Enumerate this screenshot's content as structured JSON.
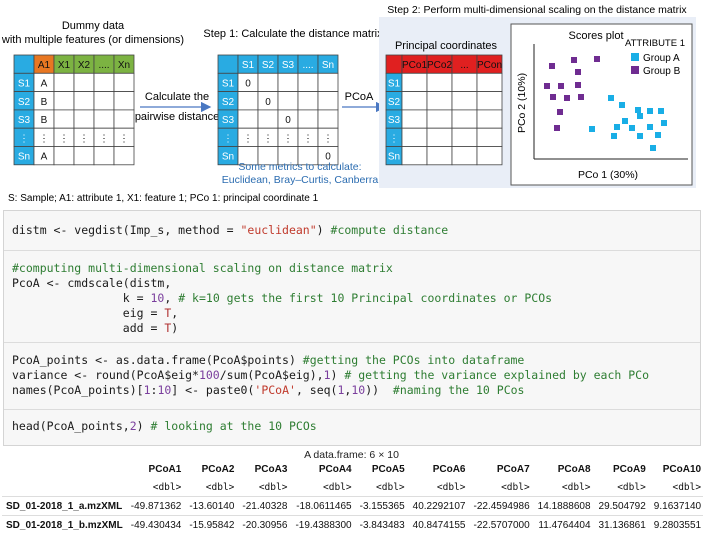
{
  "figure": {
    "dummy_title_1": "Dummy data",
    "dummy_title_2": "with multiple features (or dimensions)",
    "dummy_header": [
      "A1",
      "X1",
      "X2",
      "....",
      "Xn"
    ],
    "dummy_rows": [
      "S1",
      "S2",
      "S3",
      "⋮",
      "Sn"
    ],
    "dummy_attr": [
      "A",
      "B",
      "B",
      "⋮",
      "A"
    ],
    "step1_title": "Step 1: Calculate the distance matrix",
    "arrow1_label_1": "Calculate the",
    "arrow1_label_2": "pairwise distance",
    "dist_header": [
      "S1",
      "S2",
      "S3",
      "....",
      "Sn"
    ],
    "dist_rows": [
      "S1",
      "S2",
      "S3",
      "⋮",
      "Sn"
    ],
    "dist_zero": "0",
    "metrics_1": "Some metrics to calculate:",
    "metrics_2": "Euclidean, Bray–Curtis, Canberra",
    "step2_title": "Step 2: Perform multi-dimensional scaling on the distance matrix",
    "arrow2_label": "PCoA",
    "pc_title": "Principal coordinates",
    "pc_header": [
      "PCo1",
      "PCo2",
      "...",
      "PCon"
    ],
    "pc_rows": [
      "S1",
      "S2",
      "S3",
      "⋮",
      "Sn"
    ],
    "scores_title": "Scores plot",
    "scores_xlabel": "PCo 1 (30%)",
    "scores_ylabel": "PCo 2 (10%)",
    "legend_title": "ATTRIBUTE 1",
    "legend_a": "Group A",
    "legend_b": "Group B",
    "footnote": "S: Sample; A1: attribute 1, X1: feature 1; PCo 1: principal coordinate 1",
    "colors": {
      "orange": "#e87722",
      "green": "#7cb342",
      "blue_cell": "#29abe2",
      "red_cell": "#e02020",
      "groupA": "#19aee6",
      "groupB": "#6f2c91",
      "panel_bg": "#e9eef7",
      "text_blue": "#2b6cb0"
    }
  },
  "code": {
    "c1": {
      "a": "distm <- vegdist(Imp_s, method = ",
      "s": "\"euclidean\"",
      "b": ") ",
      "c": "#compute distance"
    },
    "c2": {
      "l1": "#computing multi-dimensional scaling on distance matrix",
      "l2": "PcoA <- cmdscale(distm,",
      "l3a": "                k = ",
      "l3n": "10",
      "l3b": ", ",
      "l3c": "# k=10 gets the first 10 Principal coordinates or PCOs",
      "l4a": "                eig = ",
      "l4t": "T",
      "l4b": ",",
      "l5a": "                add = ",
      "l5t": "T",
      "l5b": ")"
    },
    "c3": {
      "l1a": "PcoA_points <- as.data.frame(PcoA$points) ",
      "l1c": "#getting the PCOs into dataframe",
      "l2a": "variance <- round(PcoA$eig*",
      "l2n": "100",
      "l2b": "/sum(PcoA$eig),",
      "l2m": "1",
      "l2d": ") ",
      "l2c": "# getting the variance explained by each PCo",
      "l3a": "names(PcoA_points)[",
      "l3n1": "1",
      "l3b": ":",
      "l3n2": "10",
      "l3c": "] <- paste0(",
      "l3s": "'PCoA'",
      "l3d": ", seq(",
      "l3n3": "1",
      "l3e": ",",
      "l3n4": "10",
      "l3f": "))  ",
      "l3g": "#naming the 10 PCos"
    },
    "c4": {
      "a": "head(PcoA_points,",
      "n": "2",
      "b": ") ",
      "c": "# looking at the 10 PCOs"
    }
  },
  "table": {
    "caption": "A data.frame: 6 × 10",
    "columns": [
      "PCoA1",
      "PCoA2",
      "PCoA3",
      "PCoA4",
      "PCoA5",
      "PCoA6",
      "PCoA7",
      "PCoA8",
      "PCoA9",
      "PCoA10"
    ],
    "dtype": "<dbl>",
    "rows": [
      {
        "name": "SD_01-2018_1_a.mzXML",
        "values": [
          "-49.871362",
          "-13.60140",
          "-21.40328",
          "-18.0611465",
          "-3.155365",
          "40.2292107",
          "-22.4594986",
          "14.1888608",
          "29.504792",
          "9.1637140"
        ]
      },
      {
        "name": "SD_01-2018_1_b.mzXML",
        "values": [
          "-49.430434",
          "-15.95842",
          "-20.30956",
          "-19.4388300",
          "-3.843483",
          "40.8474155",
          "-22.5707000",
          "11.4764404",
          "31.136861",
          "9.2803551"
        ]
      }
    ]
  }
}
